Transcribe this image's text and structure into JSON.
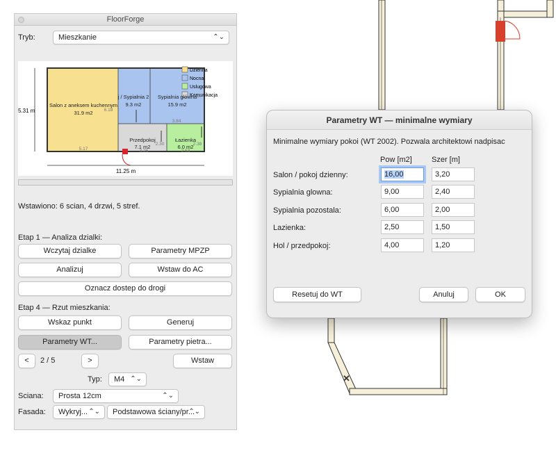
{
  "palette": {
    "title": "FloorForge",
    "mode_label": "Tryb:",
    "mode_value": "Mieszkanie",
    "status": "Wstawiono: 6 scian, 4 drzwi, 5 stref.",
    "progress": 0,
    "stage1_label": "Etap 1 — Analiza dzialki:",
    "buttons": {
      "load_plot": "Wczytaj dzialke",
      "mpzp": "Parametry MPZP",
      "analyze": "Analizuj",
      "insert_ac": "Wstaw do AC",
      "road_access": "Oznacz dostep do drogi",
      "point": "Wskaz punkt",
      "generate": "Generuj",
      "wt_params": "Parametry WT...",
      "floor_params": "Parametry pietra...",
      "prev": "<",
      "next": ">",
      "insert": "Wstaw"
    },
    "stage4_label": "Etap 4 — Rzut mieszkania:",
    "pager": "2 / 5",
    "type_label": "Typ:",
    "type_value": "M4",
    "wall_label": "Sciana:",
    "wall_value": "Prosta 12cm",
    "facade_label": "Fasada:",
    "facade_value1": "Wykryj...",
    "facade_value2": "Podstawowa ściany/pr..."
  },
  "preview": {
    "legend": [
      {
        "label": "Dzienna",
        "color": "#f7e08f"
      },
      {
        "label": "Nocna",
        "color": "#a9c4ef"
      },
      {
        "label": "Uslugowa",
        "color": "#b8ef9e"
      },
      {
        "label": "Komunikacja",
        "color": "#d9d9d9"
      }
    ],
    "rooms": {
      "salon_name": "Salon z aneksem kuchennym",
      "salon_area": "31.9 m2",
      "salon_dim": "6.18",
      "sypialnia1_name": "j / Sypialnia 2",
      "sypialnia1_area": "9.3 m2",
      "sypialnia2_name": "Sypialnia główna",
      "sypialnia2_area": "15.9 m2",
      "sypialnia2_dim": "4.13",
      "przedpokoj_name": "Przedpokoj",
      "przedpokoj_area": "7.1 m2",
      "przedpokoj_dim": "2.30",
      "lazienka_name": "Łazienka",
      "lazienka_area": "6.0 m2",
      "lazienka_dim": "2.53",
      "lazienka_dim2": "2.38",
      "dim_384": "3.84",
      "dim_517": "5.17",
      "dim_326": "3.26",
      "width_total": "11.25 m",
      "height_total": "5.31 m"
    }
  },
  "dialog": {
    "title": "Parametry WT — minimalne wymiary",
    "description": "Minimalne wymiary pokoi (WT 2002). Pozwala architektowi nadpisac",
    "col_area": "Pow [m2]",
    "col_width": "Szer [m]",
    "rows": [
      {
        "label": "Salon / pokoj dzienny:",
        "area": "16,00",
        "width": "3,20"
      },
      {
        "label": "Sypialnia glowna:",
        "area": "9,00",
        "width": "2,40"
      },
      {
        "label": "Sypialnia pozostala:",
        "area": "6,00",
        "width": "2,00"
      },
      {
        "label": "Lazienka:",
        "area": "2,50",
        "width": "1,50"
      },
      {
        "label": "Hol / przedpokoj:",
        "area": "4,00",
        "width": "1,20"
      }
    ],
    "reset": "Resetuj do WT",
    "cancel": "Anuluj",
    "ok": "OK"
  }
}
